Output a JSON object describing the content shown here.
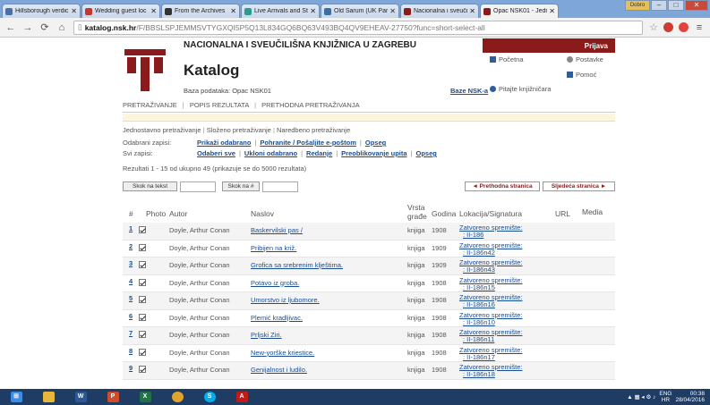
{
  "browser": {
    "tabs": [
      {
        "label": "Hillsborough verdic",
        "color": "#4a6fa5"
      },
      {
        "label": "Wedding guest loc",
        "color": "#c0392b"
      },
      {
        "label": "From the Archives",
        "color": "#333333"
      },
      {
        "label": "Live Arrivals and St",
        "color": "#2a9d8f"
      },
      {
        "label": "Old Sarum (UK Par",
        "color": "#3b6ea5"
      },
      {
        "label": "Nacionalna i sveuči",
        "color": "#8b1a1a"
      },
      {
        "label": "Opac NSK01 - Jedn",
        "color": "#8b1a1a"
      }
    ],
    "url_host": "katalog.nsk.hr",
    "url_path": "/F/BBSLSPJEMMSVTYGXQI5P5Q13L834GQ6BQ63V493BQ4QV9EHEAV-27750?func=short-select-all"
  },
  "header": {
    "library_name": "NACIONALNA I SVEUČILIŠNA KNJIŽNICA U ZAGREBU",
    "katalog_title": "Katalog",
    "database": "Baza podataka: Opac NSK01",
    "baze_link": "Baze NSK-a",
    "login": "Prijava",
    "links": {
      "home": "Početna",
      "settings": "Postavke",
      "help": "Pomoć",
      "ask": "Pitajte knjižničara"
    }
  },
  "hnav": [
    "PRETRAŽIVANJE",
    "POPIS REZULTATA",
    "PRETHODNA PRETRAŽIVANJA"
  ],
  "search_types": [
    "Jednostavno pretraživanje",
    "Složeno pretraživanje",
    "Naredbeno pretraživanje"
  ],
  "selected_row": {
    "label": "Odabrani zapisi:",
    "links": [
      "Prikaži odabrano",
      "Pohranite / Pošaljite e-poštom",
      "Opseg"
    ]
  },
  "all_row": {
    "label": "Svi zapisi:",
    "links": [
      "Odaberi sve",
      "Ukloni odabrano",
      "Redanje",
      "Preoblikovanje upita",
      "Opseg"
    ]
  },
  "results_text": "Rezultati 1 - 15 od ukupno 49 (prikazuje se do 5000 rezultata)",
  "toolbar": {
    "sort_text": "Skok na tekst",
    "sort_num": "Skok na #",
    "prev": "◄ Prethodna stranica",
    "next": "Sljedeća stranica ►"
  },
  "table": {
    "headers": {
      "num": "#",
      "photo": "Photo",
      "author": "Autor",
      "title": "Naslov",
      "type1": "Vrsta",
      "type2": "građe",
      "year": "Godina",
      "location": "Lokacija/Signatura",
      "url": "URL",
      "media": "Media"
    },
    "rows": [
      {
        "num": "1",
        "author": "Doyle, Arthur Conan",
        "title": "Baskervilski pas /",
        "type": "knjiga",
        "year": "1908",
        "loc": "Zatvoreno spremište:",
        "sig": "II-186"
      },
      {
        "num": "2",
        "author": "Doyle, Arthur Conan",
        "title": "Pribijen na križ.",
        "type": "knjiga",
        "year": "1909",
        "loc": "Zatvoreno spremište:",
        "sig": "II-186n42"
      },
      {
        "num": "3",
        "author": "Doyle, Arthur Conan",
        "title": "Grofica sa srebrenim klještima.",
        "type": "knjiga",
        "year": "1909",
        "loc": "Zatvoreno spremište:",
        "sig": "II-186n43"
      },
      {
        "num": "4",
        "author": "Doyle, Arthur Conan",
        "title": "Potavo iz groba.",
        "type": "knjiga",
        "year": "1908",
        "loc": "Zatvoreno spremište:",
        "sig": "II-186n15"
      },
      {
        "num": "5",
        "author": "Doyle, Arthur Conan",
        "title": "Umorstvo iz ljubomore.",
        "type": "knjiga",
        "year": "1908",
        "loc": "Zatvoreno spremište:",
        "sig": "II-186n16"
      },
      {
        "num": "6",
        "author": "Doyle, Arthur Conan",
        "title": "Plemić kradljivac.",
        "type": "knjiga",
        "year": "1908",
        "loc": "Zatvoreno spremište:",
        "sig": "II-186n10"
      },
      {
        "num": "7",
        "author": "Doyle, Arthur Conan",
        "title": "Prljski Ziri.",
        "type": "knjiga",
        "year": "1908",
        "loc": "Zatvoreno spremište:",
        "sig": "II-186n11"
      },
      {
        "num": "8",
        "author": "Doyle, Arthur Conan",
        "title": "New-yorške kriestice.",
        "type": "knjiga",
        "year": "1908",
        "loc": "Zatvoreno spremište:",
        "sig": "II-186n17"
      },
      {
        "num": "9",
        "author": "Doyle, Arthur Conan",
        "title": "Genijalnost i ludilo.",
        "type": "knjiga",
        "year": "1908",
        "loc": "Zatvoreno spremište:",
        "sig": "II-186n18"
      }
    ]
  },
  "taskbar": {
    "lang": "ENG",
    "region": "HR",
    "time": "00:38",
    "date": "28/04/2016"
  },
  "colors": {
    "accent": "#8b1a1a",
    "link": "#1a4d8f"
  }
}
